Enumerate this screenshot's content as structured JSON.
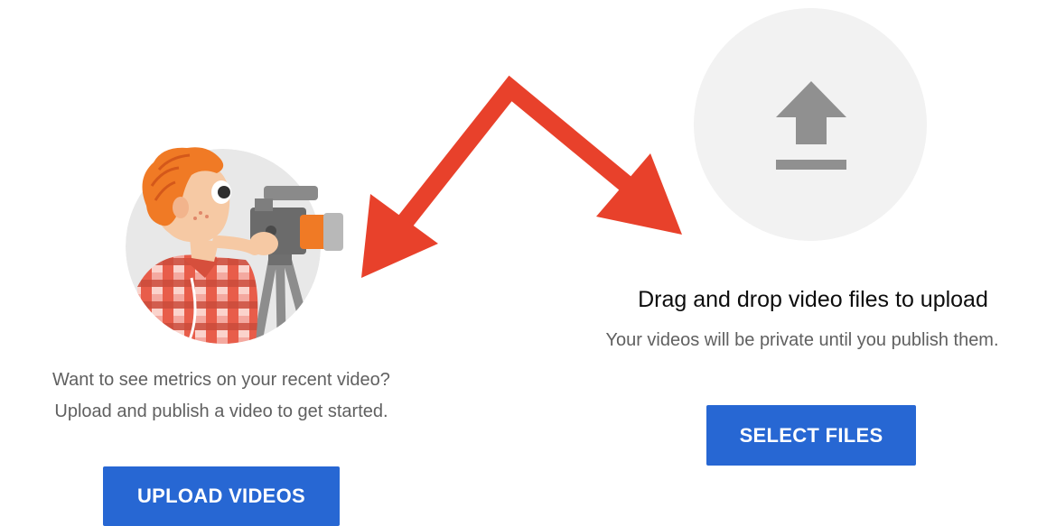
{
  "left_panel": {
    "metrics_line1": "Want to see metrics on your recent video?",
    "metrics_line2": "Upload and publish a video to get started.",
    "upload_button_label": "UPLOAD VIDEOS"
  },
  "right_panel": {
    "drop_title": "Drag and drop video files to upload",
    "drop_subtitle": "Your videos will be private until you publish them.",
    "select_button_label": "SELECT FILES"
  },
  "icons": {
    "illustration": "videographer-illustration",
    "upload": "upload-arrow-icon",
    "annotation_arrows": "red-annotation-arrows"
  },
  "colors": {
    "button_blue": "#2767d3",
    "annotation_red": "#e8412b",
    "muted_text": "#606060",
    "title_text": "#0d0d0d",
    "icon_gray": "#909090",
    "circle_bg": "#f2f2f2"
  }
}
